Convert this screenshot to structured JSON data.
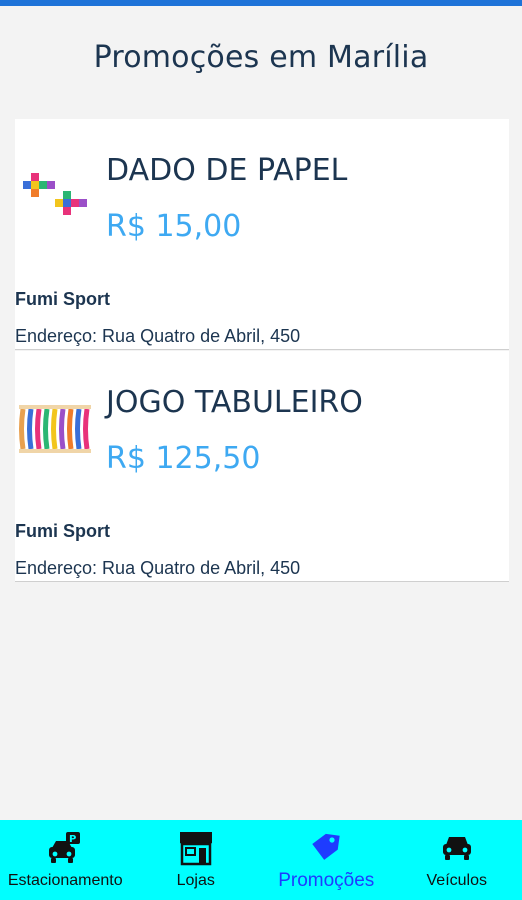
{
  "header": {
    "title": "Promoções em Marília"
  },
  "promotions": [
    {
      "title": "DADO DE PAPEL",
      "price": "R$ 15,00",
      "store": "Fumi Sport",
      "address": "Endereço: Rua Quatro de Abril, 450",
      "image_icon": "paper-dice-image"
    },
    {
      "title": "JOGO TABULEIRO",
      "price": "R$ 125,50",
      "store": "Fumi Sport",
      "address": "Endereço: Rua Quatro de Abril, 450",
      "image_icon": "board-game-image"
    }
  ],
  "nav": {
    "items": [
      {
        "label": "Estacionamento",
        "icon": "parking-car-icon"
      },
      {
        "label": "Lojas",
        "icon": "store-icon"
      },
      {
        "label": "Promoções",
        "icon": "tag-icon",
        "active": true
      },
      {
        "label": "Veículos",
        "icon": "car-icon"
      }
    ]
  },
  "colors": {
    "accent_bar": "#1e73d8",
    "nav_bg": "#00ffff",
    "price": "#3ea9f2",
    "title_text": "#1c3550",
    "active_nav": "#1e3cff"
  }
}
